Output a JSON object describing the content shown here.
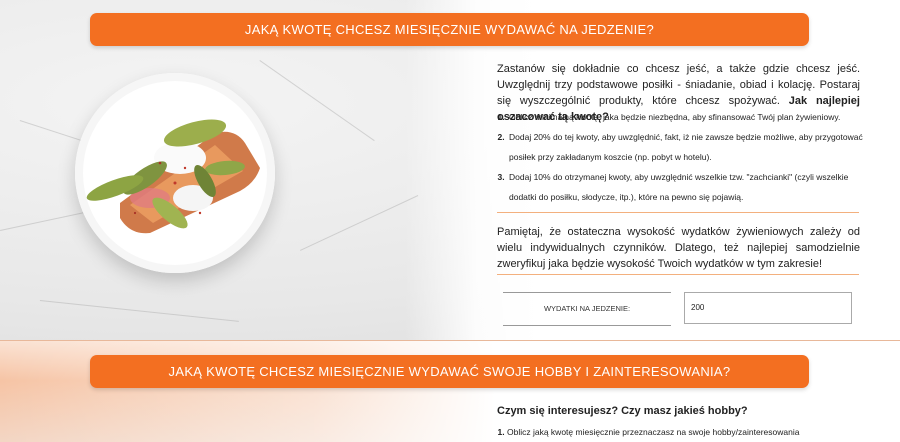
{
  "sections": [
    {
      "title": "JAKĄ KWOTĘ CHCESZ MIESIĘCZNIE WYDAWAĆ NA JEDZENIE?",
      "intro_text": "Zastanów się dokładnie co chcesz jeść, a także gdzie chcesz jeść. Uwzględnij trzy podstawowe posiłki - śniadanie, obiad i kolację. Postaraj się wyszczególnić produkty, które chcesz spożywać. ",
      "intro_bold": "Jak najlepiej oszacować tą kwotę?",
      "steps": [
        "Oblicz minimalną kwotę, jaka będzie niezbędna, aby sfinansować Twój plan żywieniowy.",
        "Dodaj 20% do tej kwoty, aby uwzględnić, fakt, iż nie zawsze będzie możliwe, aby przygotować posiłek przy zakładanym koszcie (np. pobyt w hotelu).",
        "Dodaj 10% do otrzymanej kwoty, aby uwzględnić wszelkie tzw. \"zachcianki\" (czyli wszelkie dodatki do posiłku, słodycze, itp.), które na pewno się pojawią."
      ],
      "note": "Pamiętaj, że ostateczna wysokość wydatków żywieniowych zależy od wielu indywidualnych czynników. Dlatego, też najlepiej samodzielnie zweryfikuj jaka będzie wysokość Twoich wydatków w tym zakresie!",
      "field_label": "WYDATKI NA JEDZENIE:",
      "field_value": "200"
    },
    {
      "title": "JAKĄ KWOTĘ CHCESZ MIESIĘCZNIE WYDAWAĆ SWOJE HOBBY I ZAINTERESOWANIA?",
      "question": "Czym się interesujesz? Czy masz jakieś hobby?",
      "steps": [
        "Oblicz jaką kwotę miesięcznie przeznaczasz na swoje hobby/zainteresowania"
      ]
    }
  ],
  "colors": {
    "accent": "#f36f21"
  },
  "images": {
    "food_plate": "food-plate-image"
  }
}
